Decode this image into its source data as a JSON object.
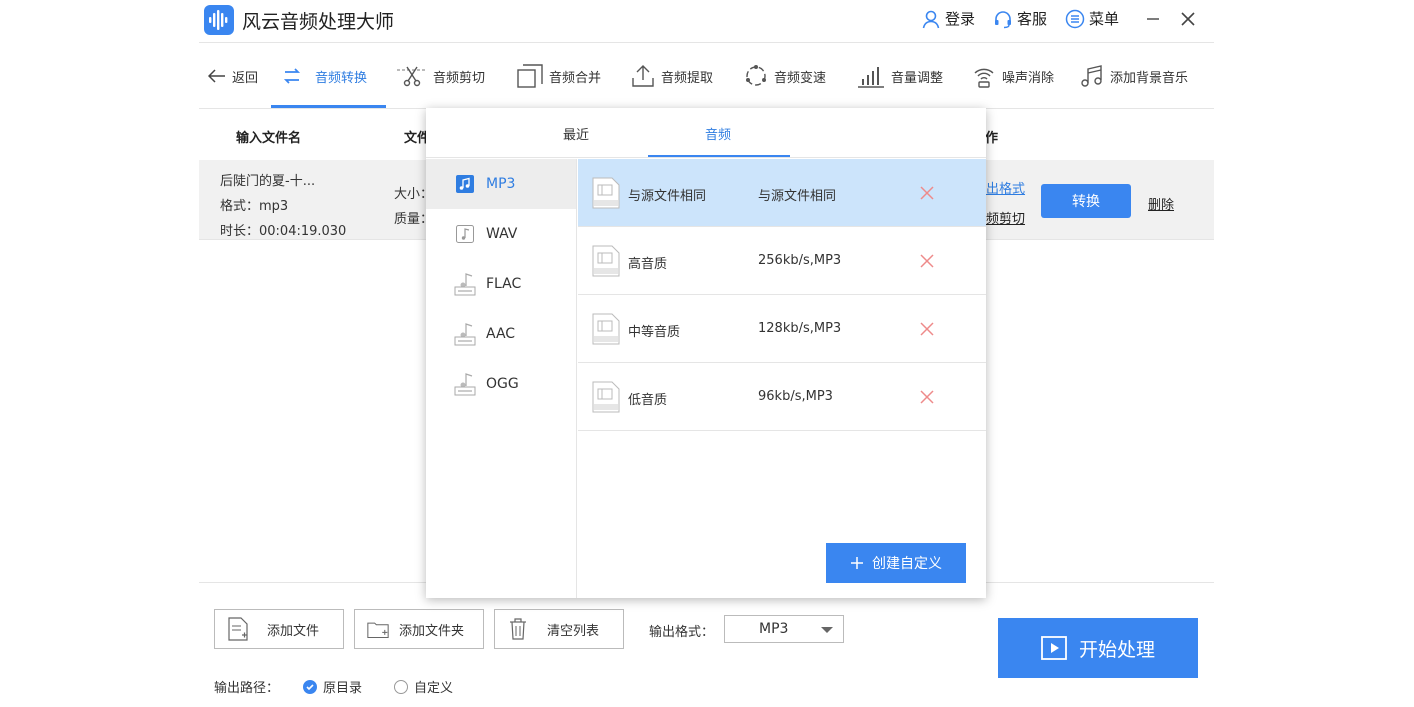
{
  "app": {
    "title": "风云音频处理大师"
  },
  "titlebar": {
    "login": "登录",
    "service": "客服",
    "menu": "菜单"
  },
  "toolbar": {
    "back": "返回",
    "tabs": [
      "音频转换",
      "音频剪切",
      "音频合并",
      "音频提取",
      "音频变速",
      "音量调整",
      "噪声消除",
      "添加背景音乐"
    ],
    "active_tab": "音频转换"
  },
  "table": {
    "headers": {
      "input_name": "输入文件名",
      "file_partial": "文件",
      "action_partial": "作"
    },
    "row": {
      "name": "后陡门的夏-十...",
      "format": "格式：mp3",
      "duration": "时长：00:04:19.030",
      "size_partial": "大小：",
      "quality_partial": "质量：",
      "output_format_link": "出格式",
      "cut_link": "频剪切",
      "convert": "转换",
      "delete": "删除"
    }
  },
  "popup": {
    "tabs": [
      "最近",
      "音频"
    ],
    "active_tab": "音频",
    "formats": [
      "MP3",
      "WAV",
      "FLAC",
      "AAC",
      "OGG"
    ],
    "active_format": "MP3",
    "presets": [
      {
        "name": "与源文件相同",
        "value": "与源文件相同"
      },
      {
        "name": "高音质",
        "value": "256kb/s,MP3"
      },
      {
        "name": "中等音质",
        "value": "128kb/s,MP3"
      },
      {
        "name": "低音质",
        "value": "96kb/s,MP3"
      }
    ],
    "create_button": "创建自定义"
  },
  "bottom": {
    "add_file": "添加文件",
    "add_folder": "添加文件夹",
    "clear_list": "清空列表",
    "output_format_label": "输出格式：",
    "output_format_value": "MP3",
    "start": "开始处理",
    "output_path_label": "输出路径：",
    "path_options": [
      "原目录",
      "自定义"
    ],
    "path_selected": "原目录"
  },
  "colors": {
    "accent": "#3a86f0",
    "selected_row": "#cce4fb",
    "delete_x": "#ee8a8a"
  }
}
